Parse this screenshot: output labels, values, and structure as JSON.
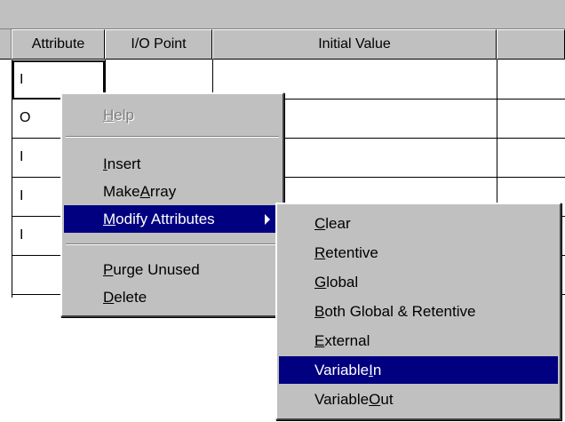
{
  "grid": {
    "headers": [
      "Attribute",
      "I/O Point",
      "Initial Value"
    ],
    "attribute_values": [
      "I",
      "O",
      "I",
      "I",
      "I"
    ]
  },
  "context_menu": {
    "help": {
      "label": "Help",
      "key": "H",
      "rest": "elp"
    },
    "insert": {
      "label": "Insert",
      "key": "I",
      "rest": "nsert"
    },
    "make_array": {
      "label": "Make Array",
      "pre": "Make ",
      "key": "A",
      "rest": "rray"
    },
    "modify_attributes": {
      "label": "Modify Attributes",
      "key": "M",
      "rest": "odify Attributes"
    },
    "purge_unused": {
      "label": "Purge Unused",
      "key": "P",
      "rest": "urge Unused"
    },
    "delete": {
      "label": "Delete",
      "key": "D",
      "rest": "elete"
    }
  },
  "submenu": {
    "clear": {
      "label": "Clear",
      "key": "C",
      "rest": "lear"
    },
    "retentive": {
      "label": "Retentive",
      "key": "R",
      "rest": "etentive"
    },
    "global": {
      "label": "Global",
      "key": "G",
      "rest": "lobal"
    },
    "both": {
      "label": "Both Global & Retentive",
      "key": "B",
      "rest": "oth Global & Retentive"
    },
    "external": {
      "label": "External",
      "key": "E",
      "rest": "xternal"
    },
    "variable_in": {
      "label": "Variable In",
      "pre": "Variable ",
      "key": "I",
      "rest": "n"
    },
    "variable_out": {
      "label": "Variable Out",
      "pre": "Variable ",
      "key": "O",
      "rest": "ut"
    }
  },
  "colors": {
    "menu_face": "#c0c0c0",
    "highlight": "#000080",
    "disabled_text": "#808080"
  }
}
